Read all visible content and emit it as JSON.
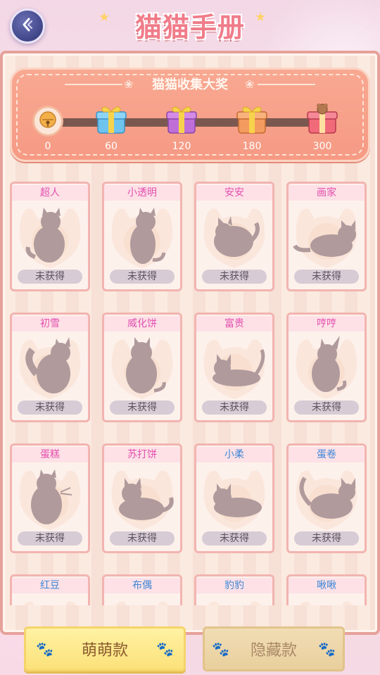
{
  "header": {
    "title": "猫猫手册",
    "back_icon": "back-arrow-icon"
  },
  "reward": {
    "title": "猫猫收集大奖",
    "milestones": [
      {
        "label": "0",
        "icon": "bell-icon"
      },
      {
        "label": "60",
        "icon": "blue-gift-icon"
      },
      {
        "label": "120",
        "icon": "purple-gift-icon"
      },
      {
        "label": "180",
        "icon": "orange-gift-icon"
      },
      {
        "label": "300",
        "icon": "red-gift-icon"
      }
    ]
  },
  "cats": [
    {
      "name": "超人",
      "status": "未获得",
      "name_color": "#e34fb0"
    },
    {
      "name": "小透明",
      "status": "未获得",
      "name_color": "#e34fb0"
    },
    {
      "name": "安安",
      "status": "未获得",
      "name_color": "#e34fb0"
    },
    {
      "name": "画家",
      "status": "未获得",
      "name_color": "#e34fb0"
    },
    {
      "name": "初雪",
      "status": "未获得",
      "name_color": "#e34fb0"
    },
    {
      "name": "威化饼",
      "status": "未获得",
      "name_color": "#e34fb0"
    },
    {
      "name": "富贵",
      "status": "未获得",
      "name_color": "#e34fb0"
    },
    {
      "name": "哼哼",
      "status": "未获得",
      "name_color": "#e34fb0"
    },
    {
      "name": "蛋糕",
      "status": "未获得",
      "name_color": "#e34fb0"
    },
    {
      "name": "苏打饼",
      "status": "未获得",
      "name_color": "#e34fb0"
    },
    {
      "name": "小柔",
      "status": "未获得",
      "name_color": "#3f86d6"
    },
    {
      "name": "蛋卷",
      "status": "未获得",
      "name_color": "#3f86d6"
    },
    {
      "name": "红豆",
      "status": "",
      "name_color": "#3f86d6"
    },
    {
      "name": "布偶",
      "status": "",
      "name_color": "#3f86d6"
    },
    {
      "name": "豹豹",
      "status": "",
      "name_color": "#3f86d6"
    },
    {
      "name": "啾啾",
      "status": "",
      "name_color": "#3f86d6"
    }
  ],
  "tabs": {
    "active_label": "萌萌款",
    "inactive_label": "隐藏款"
  },
  "colors": {
    "panel_border": "#e6a19a",
    "reward_bg": "#f69a84",
    "silhouette": "#b09a9c",
    "tab_active": "#fbe17a"
  }
}
